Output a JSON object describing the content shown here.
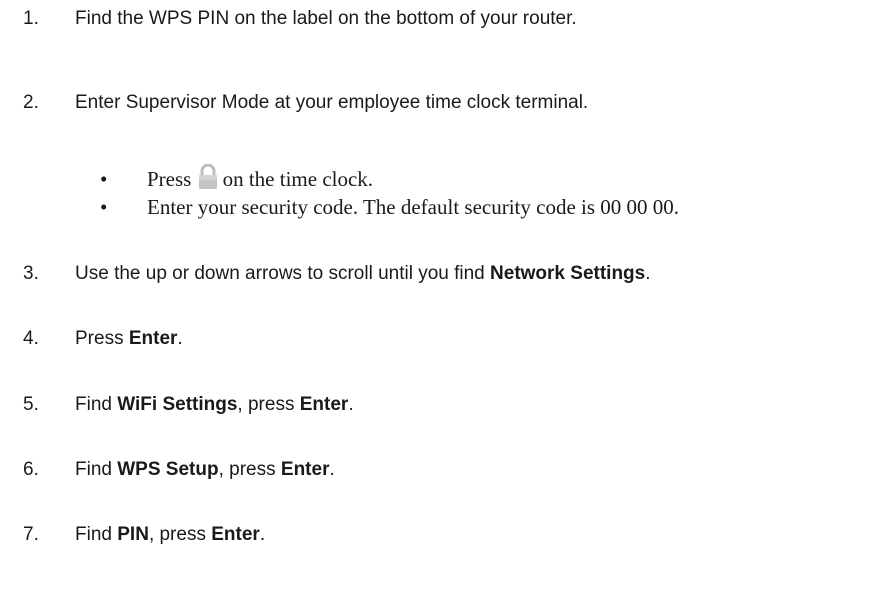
{
  "steps": [
    {
      "num": "1.",
      "parts": [
        {
          "t": "Find the WPS PIN on the label on the bottom of your router."
        }
      ]
    },
    {
      "num": "2.",
      "parts": [
        {
          "t": "Enter Supervisor Mode at your employee time clock terminal."
        }
      ]
    },
    {
      "num": "3.",
      "parts": [
        {
          "t": "Use the up or down arrows to scroll until you find "
        },
        {
          "t": "Network Settings",
          "b": true
        },
        {
          "t": "."
        }
      ]
    },
    {
      "num": "4.",
      "parts": [
        {
          "t": "Press "
        },
        {
          "t": "Enter",
          "b": true
        },
        {
          "t": "."
        }
      ]
    },
    {
      "num": "5.",
      "parts": [
        {
          "t": "Find "
        },
        {
          "t": "WiFi Settings",
          "b": true
        },
        {
          "t": ", press "
        },
        {
          "t": "Enter",
          "b": true
        },
        {
          "t": "."
        }
      ]
    },
    {
      "num": "6.",
      "parts": [
        {
          "t": "Find "
        },
        {
          "t": "WPS Setup",
          "b": true
        },
        {
          "t": ", press "
        },
        {
          "t": "Enter",
          "b": true
        },
        {
          "t": "."
        }
      ]
    },
    {
      "num": "7.",
      "parts": [
        {
          "t": "Find "
        },
        {
          "t": "PIN",
          "b": true
        },
        {
          "t": ", press "
        },
        {
          "t": "Enter",
          "b": true
        },
        {
          "t": "."
        }
      ]
    }
  ],
  "bullets": {
    "dot": "•",
    "press_before": "Press",
    "lock_icon": "lock-icon",
    "press_after": "on the time clock.",
    "security": "Enter your security code. The default security code is 00 00 00."
  }
}
